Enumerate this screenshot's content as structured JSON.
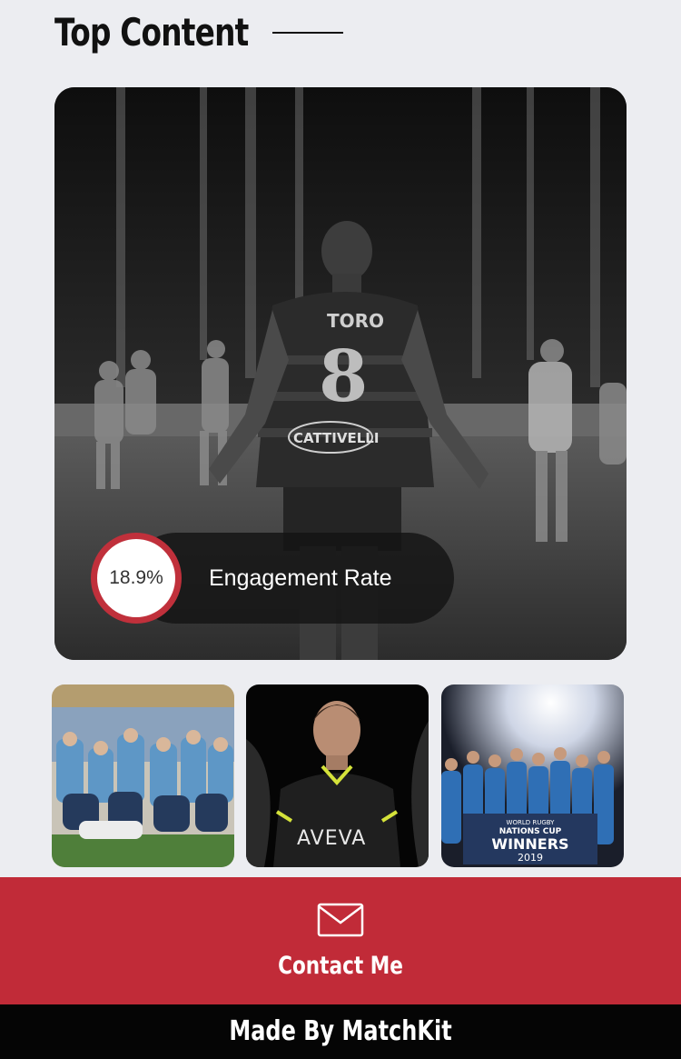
{
  "section": {
    "title": "Top Content"
  },
  "hero": {
    "engagement_value": "18.9%",
    "engagement_label": "Engagement Rate",
    "jersey_text": "TORO",
    "jersey_number": "8",
    "sponsor": "CATTIVELLI"
  },
  "thumbnails": [
    {
      "name": "team-celebration-photo"
    },
    {
      "name": "player-portrait-photo",
      "shirt_text": "AVEVA"
    },
    {
      "name": "trophy-celebration-photo",
      "banner_line1": "WORLD RUGBY",
      "banner_line2": "NATIONS CUP",
      "banner_line3": "WINNERS",
      "banner_line4": "2019"
    }
  ],
  "contact": {
    "icon": "envelope-icon",
    "label": "Contact Me"
  },
  "footer": {
    "label": "Made By MatchKit"
  },
  "colors": {
    "accent": "#c12b38",
    "background": "#ecedf1",
    "footer": "#050505"
  }
}
